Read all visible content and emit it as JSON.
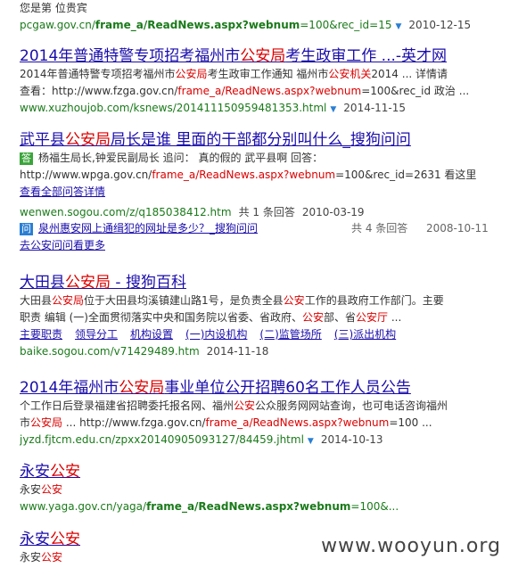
{
  "results": [
    {
      "snippet": "您是第 位贵宾",
      "url_plain": "pcgaw.gov.cn/",
      "url_bold": "frame_a/ReadNews.aspx?webnum",
      "url_tail": "=100&rec_id=15",
      "date": "2010-12-15"
    },
    {
      "title_a": "2014年普通特警专项招考福州市",
      "title_hl": "公安局",
      "title_b": "考生政审工作 ...-英才网",
      "line1_a": "2014年普通特警专项招考福州市",
      "line1_red": "公安局",
      "line1_b": "考生政审工作通知 福州市",
      "line1_red2": "公安机关",
      "line1_c": "2014 ... 详情请",
      "line2_a": "查看：http://www.fzga.gov.cn/",
      "line2_red": "frame_a/ReadNews.aspx?webnum",
      "line2_b": "=100&rec_id 政治 ...",
      "url": "www.xuzhoujob.com/ksnews/20141115095948135​3.html",
      "date": "2014-11-15"
    },
    {
      "title_a": "武平县",
      "title_hl": "公安局",
      "title_b": "局长是谁 里面的干部都分别叫什么_搜狗问问",
      "badge": "答",
      "line1": "杨福生局长,钟爱民副局长 追问： 真的假的 武平县啊 回答：",
      "line2_a": "http://www.wpga.gov.cn/",
      "line2_red": "frame_a/ReadNews.aspx?webnum",
      "line2_b": "=100&rec_id=2631 看这里",
      "see_all": "查看全部问答详情",
      "url": "wenwen.sogou.com/z/q185038412.htm",
      "count": "共 1 条回答",
      "date": "2010-03-19",
      "q_badge": "问",
      "q_text": "泉州惠安网上通缉犯的网址是多少？_搜狗问问",
      "q_count": "共 4 条回答",
      "q_date": "2008-10-11",
      "more": "去公安问问看更多"
    },
    {
      "title_a": "大田县",
      "title_hl": "公安局",
      "title_b": " - 搜狗百科",
      "line1_a": "大田县",
      "line1_red": "公安局",
      "line1_b": "位于大田县均溪镇建山路1号，是负责全县",
      "line1_red2": "公安",
      "line1_c": "工作的县政府工作部门。主要",
      "line2_a": "职责 编辑 (一)全面贯彻落实中央和国务院以省委、省政府、",
      "line2_red": "公安",
      "line2_b": "部、省",
      "line2_red2": "公安厅",
      "line2_c": " ...",
      "links": [
        "主要职责",
        "领导分工",
        "机构设置",
        "(一)内设机构",
        "(二)监管场所",
        "(三)派出机构"
      ],
      "url": "baike.sogou.com/v71429489.htm",
      "date": "2014-11-18"
    },
    {
      "title_a": "2014年福州市",
      "title_hl": "公安局",
      "title_b": "事业单位公开招聘60名工作人员公告",
      "line1_a": "个工作日后登录福建省招聘委托报名网、福州",
      "line1_red": "公安",
      "line1_b": "公众服务网网站查询，也可电话咨询福州",
      "line2_a": "市",
      "line2_red": "公安局",
      "line2_b": " ... http://www.fzga.gov.cn/",
      "line2_red2": "frame_a/ReadNews.aspx?webnum",
      "line2_c": "=100 ...",
      "url": "jyzd.fjtcm.edu.cn/zpxx20140905093127/84459.jhtml",
      "date": "2014-10-13"
    },
    {
      "title_a": "永安",
      "title_hl": "公安",
      "line1_a": "永安",
      "line1_red": "公安",
      "url_plain": "www.yaga.gov.cn/yaga/",
      "url_bold": "frame_a/ReadNews.aspx?webnum",
      "url_tail": "=100&..."
    },
    {
      "title_a": "永安",
      "title_hl": "公安",
      "line1_a": "永安",
      "line1_red": "公安"
    }
  ],
  "watermark": "www.wooyun.org",
  "colors": {
    "link": "#1a0dab",
    "highlight": "#dd0000",
    "url": "#1a7a1a"
  }
}
